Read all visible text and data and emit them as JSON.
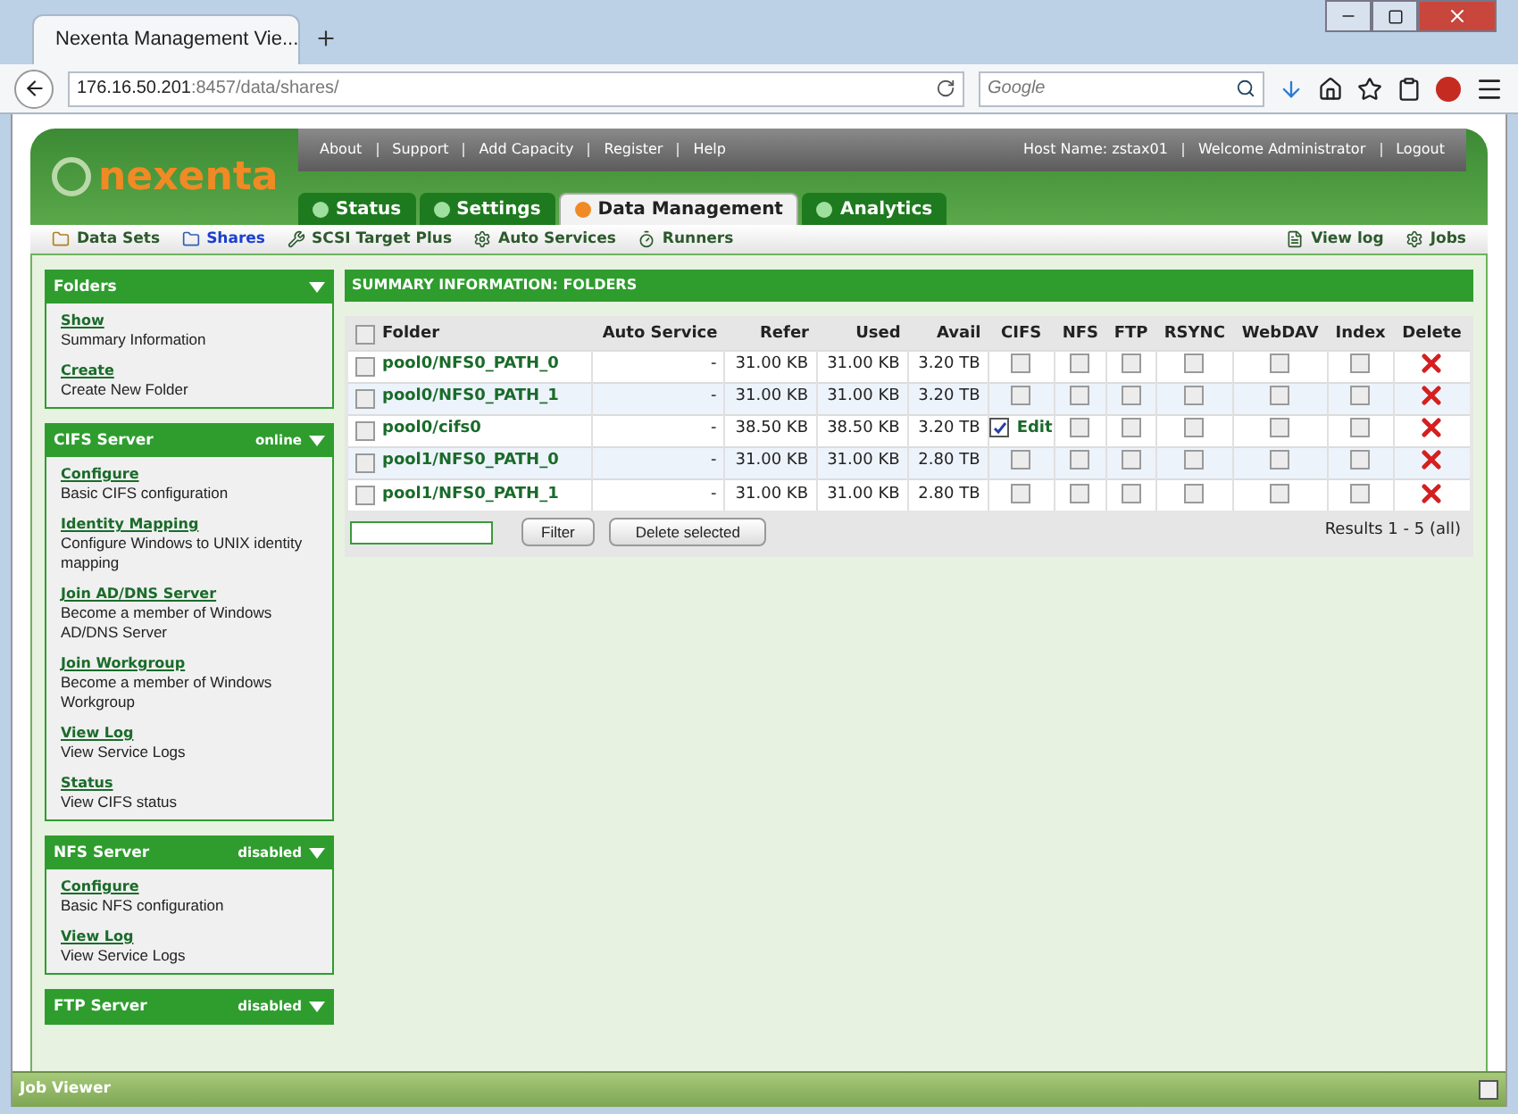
{
  "browser": {
    "tab_title": "Nexenta Management Vie...",
    "url_host": "176.16.50.201",
    "url_rest": ":8457/data/shares/",
    "search_placeholder": "Google"
  },
  "header": {
    "logo": "nexenta",
    "top_links": [
      "About",
      "Support",
      "Add Capacity",
      "Register",
      "Help"
    ],
    "host": "Host Name: zstax01",
    "welcome": "Welcome Administrator",
    "logout": "Logout",
    "tabs": [
      {
        "label": "Status",
        "selected": false
      },
      {
        "label": "Settings",
        "selected": false
      },
      {
        "label": "Data Management",
        "selected": true
      },
      {
        "label": "Analytics",
        "selected": false
      }
    ],
    "subnav": [
      {
        "label": "Data Sets",
        "selected": false
      },
      {
        "label": "Shares",
        "selected": true
      },
      {
        "label": "SCSI Target Plus",
        "selected": false
      },
      {
        "label": "Auto Services",
        "selected": false
      },
      {
        "label": "Runners",
        "selected": false
      }
    ],
    "subnav_right": [
      "View log",
      "Jobs"
    ]
  },
  "sidebar": [
    {
      "title": "Folders",
      "items": [
        {
          "link": "Show",
          "desc": "Summary Information"
        },
        {
          "link": "Create",
          "desc": "Create New Folder"
        }
      ]
    },
    {
      "title": "CIFS Server",
      "status": "online",
      "items": [
        {
          "link": "Configure",
          "desc": "Basic CIFS configuration"
        },
        {
          "link": "Identity Mapping",
          "desc": "Configure Windows to UNIX identity mapping"
        },
        {
          "link": "Join AD/DNS Server",
          "desc": "Become a member of Windows AD/DNS Server"
        },
        {
          "link": "Join Workgroup",
          "desc": "Become a member of Windows Workgroup"
        },
        {
          "link": "View Log",
          "desc": "View Service Logs"
        },
        {
          "link": "Status",
          "desc": "View CIFS status"
        }
      ]
    },
    {
      "title": "NFS Server",
      "status": "disabled",
      "items": [
        {
          "link": "Configure",
          "desc": "Basic NFS configuration"
        },
        {
          "link": "View Log",
          "desc": "View Service Logs"
        }
      ]
    },
    {
      "title": "FTP Server",
      "status": "disabled"
    }
  ],
  "table": {
    "title": "SUMMARY INFORMATION: FOLDERS",
    "select_all_checked": false,
    "columns": [
      "Folder",
      "Auto Service",
      "Refer",
      "Used",
      "Avail",
      "CIFS",
      "NFS",
      "FTP",
      "RSYNC",
      "WebDAV",
      "Index",
      "Delete"
    ],
    "rows": [
      {
        "checked": false,
        "folder": "pool0/NFS0_PATH_0",
        "auto_service": "-",
        "refer": "31.00 KB",
        "used": "31.00 KB",
        "avail": "3.20 TB",
        "shares": [
          false,
          false,
          false,
          false,
          false,
          false
        ]
      },
      {
        "checked": false,
        "folder": "pool0/NFS0_PATH_1",
        "auto_service": "-",
        "refer": "31.00 KB",
        "used": "31.00 KB",
        "avail": "3.20 TB",
        "shares": [
          false,
          false,
          false,
          false,
          false,
          false
        ]
      },
      {
        "checked": false,
        "folder": "pool0/cifs0",
        "auto_service": "-",
        "refer": "38.50 KB",
        "used": "38.50 KB",
        "avail": "3.20 TB",
        "shares": [
          true,
          false,
          false,
          false,
          false,
          false
        ],
        "cifs_edit": "Edit"
      },
      {
        "checked": false,
        "folder": "pool1/NFS0_PATH_0",
        "auto_service": "-",
        "refer": "31.00 KB",
        "used": "31.00 KB",
        "avail": "2.80 TB",
        "shares": [
          false,
          false,
          false,
          false,
          false,
          false
        ]
      },
      {
        "checked": false,
        "folder": "pool1/NFS0_PATH_1",
        "auto_service": "-",
        "refer": "31.00 KB",
        "used": "31.00 KB",
        "avail": "2.80 TB",
        "shares": [
          false,
          false,
          false,
          false,
          false,
          false
        ]
      }
    ],
    "filter_button": "Filter",
    "delete_button": "Delete selected",
    "results": "Results 1 - 5 (all)"
  },
  "job_viewer": {
    "title": "Job Viewer"
  }
}
